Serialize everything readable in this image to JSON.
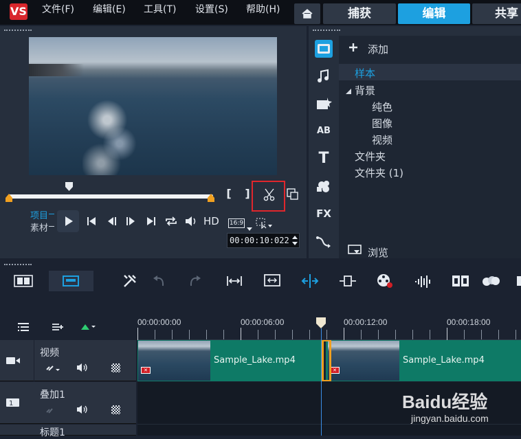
{
  "menu": {
    "logo": "VS",
    "items": [
      "文件(F)",
      "编辑(E)",
      "工具(T)",
      "设置(S)",
      "帮助(H)"
    ]
  },
  "tabs": [
    {
      "label": "捕获",
      "active": false
    },
    {
      "label": "编辑",
      "active": true
    },
    {
      "label": "共享",
      "active": false
    }
  ],
  "player": {
    "mode_project": "项目",
    "mode_clip": "素材",
    "hd_label": "HD",
    "aspect_label": "16:9",
    "timecode": "00:00:10:022",
    "mark_in": "[",
    "mark_out": "]",
    "highlight_color": "#e0262c"
  },
  "library": {
    "add_label": "添加",
    "browse_label": "浏览",
    "tree": [
      {
        "label": "样本",
        "level": 0,
        "selected": true
      },
      {
        "label": "背景",
        "level": 0,
        "expanded": true
      },
      {
        "label": "纯色",
        "level": 1
      },
      {
        "label": "图像",
        "level": 1
      },
      {
        "label": "视频",
        "level": 1
      },
      {
        "label": "文件夹",
        "level": 0
      },
      {
        "label": "文件夹 (1)",
        "level": 0
      }
    ],
    "sidebar_icons": [
      "media-icon",
      "audio-icon",
      "transition-icon",
      "title-ab-icon",
      "text-icon",
      "graphics-icon",
      "fx-icon",
      "path-icon"
    ],
    "fx_label": "FX",
    "ab_label": "AB",
    "text_label": "T"
  },
  "timeline": {
    "ruler_ticks": [
      "00:00:00:00",
      "00:00:06:00",
      "00:00:12:00",
      "00:00:18:00"
    ],
    "tracks": [
      {
        "name": "视频",
        "icon": "video-track-icon"
      },
      {
        "name": "叠加1",
        "icon": "overlay-track-icon",
        "num": "1"
      },
      {
        "name": "标题1"
      }
    ],
    "clips": [
      {
        "label": "Sample_Lake.mp4"
      },
      {
        "label": "Sample_Lake.mp4"
      }
    ],
    "accent_color": "#1da0e0",
    "clip_color": "#0e7a66",
    "marker_color": "#f0a020"
  },
  "watermark": {
    "brand": "Baidu经验",
    "url": "jingyan.baidu.com"
  }
}
